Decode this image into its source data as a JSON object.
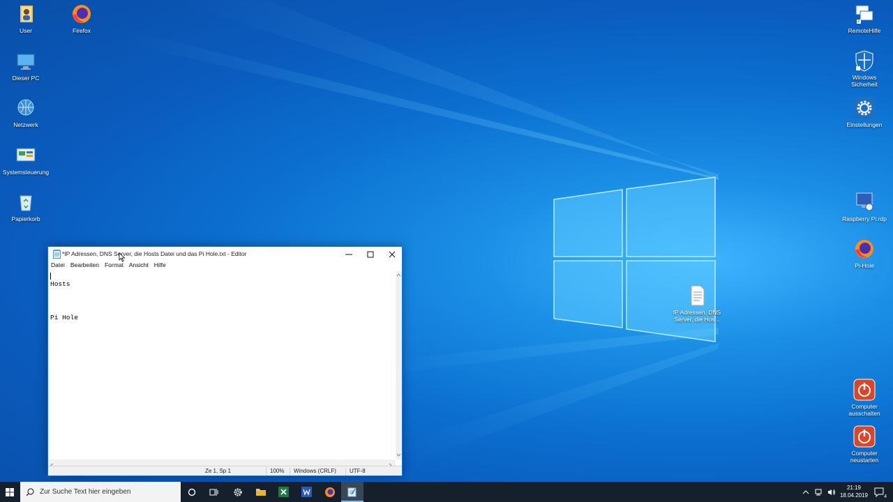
{
  "desktop": {
    "left_icons": [
      {
        "label": "User",
        "icon": "folder-user-icon"
      },
      {
        "label": "Firefox",
        "icon": "firefox-icon"
      },
      {
        "label": "Dieser PC",
        "icon": "this-pc-icon"
      },
      {
        "label": "Netzwerk",
        "icon": "network-icon"
      },
      {
        "label": "Systemsteuerung",
        "icon": "control-panel-icon"
      },
      {
        "label": "Papierkorb",
        "icon": "recycle-bin-icon"
      }
    ],
    "right_icons": [
      {
        "label": "RemoteHilfe",
        "icon": "remote-help-icon"
      },
      {
        "label": "Windows Sicherheit",
        "icon": "shield-icon"
      },
      {
        "label": "Einstellungen",
        "icon": "gear-icon"
      },
      {
        "label": "Raspberry Pi.rdp",
        "icon": "rdp-icon"
      },
      {
        "label": "Pi-Hole",
        "icon": "firefox-icon"
      },
      {
        "label": "IP Adressen, DNS Server, die Hos...",
        "icon": "text-file-icon"
      },
      {
        "label": "Computer ausschalten",
        "icon": "power-icon"
      },
      {
        "label": "Computer neustarten",
        "icon": "power-icon"
      }
    ]
  },
  "notepad": {
    "title": "*IP Adressen, DNS Server, die Hosts Datei und das Pi Hole.txt - Editor",
    "menu": [
      "Datei",
      "Bearbeiten",
      "Format",
      "Ansicht",
      "Hilfe"
    ],
    "lines": [
      "",
      "Hosts",
      "",
      "",
      "",
      "Pi Hole"
    ],
    "status": {
      "position": "Ze 1, Sp 1",
      "zoom": "100%",
      "line_ending": "Windows (CRLF)",
      "encoding": "UTF-8"
    }
  },
  "taskbar": {
    "search_placeholder": "Zur Suche Text hier eingeben",
    "apps": [
      "cortana-icon",
      "task-view-icon",
      "settings-icon",
      "file-explorer-icon",
      "excel-icon",
      "word-icon",
      "firefox-icon",
      "notepad-icon"
    ],
    "time": "21:19",
    "date": "18.04.2019",
    "notification_count": "4"
  },
  "colors": {
    "accent": "#1a73c9",
    "taskbar": "#16202c",
    "desktop": "#0b6fd0"
  }
}
